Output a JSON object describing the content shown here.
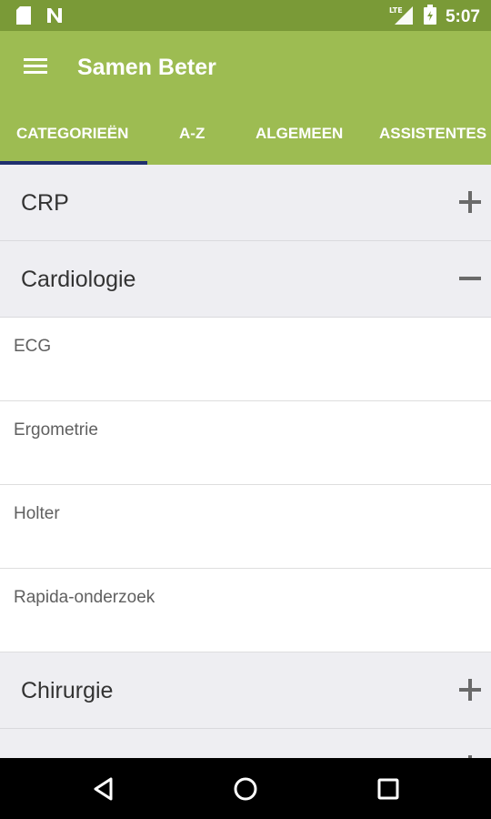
{
  "status_bar": {
    "time": "5:07",
    "network_label": "LTE",
    "icons": [
      "sd-card-icon",
      "n-notification-icon",
      "lte-signal-icon",
      "battery-icon"
    ]
  },
  "app_bar": {
    "title": "Samen Beter",
    "menu_icon": "hamburger-menu-icon"
  },
  "tabs": [
    {
      "label": "CATEGORIEËN",
      "selected": true
    },
    {
      "label": "A-Z",
      "selected": false
    },
    {
      "label": "ALGEMEEN",
      "selected": false
    },
    {
      "label": "ASSISTENTES",
      "selected": false
    }
  ],
  "categories": [
    {
      "label": "CRP",
      "expanded": false,
      "toggle_icon": "plus-icon"
    },
    {
      "label": "Cardiologie",
      "expanded": true,
      "toggle_icon": "minus-icon",
      "items": [
        "ECG",
        "Ergometrie",
        "Holter",
        "Rapida-onderzoek"
      ]
    },
    {
      "label": "Chirurgie",
      "expanded": false,
      "toggle_icon": "plus-icon"
    }
  ],
  "nav_bar": {
    "icons": [
      "back-icon",
      "home-icon",
      "recents-icon"
    ]
  },
  "colors": {
    "status_bar": "#7a9a37",
    "app_bar": "#9dbc52",
    "tab_indicator": "#1f2f6e",
    "group_background": "#eeeef2"
  }
}
